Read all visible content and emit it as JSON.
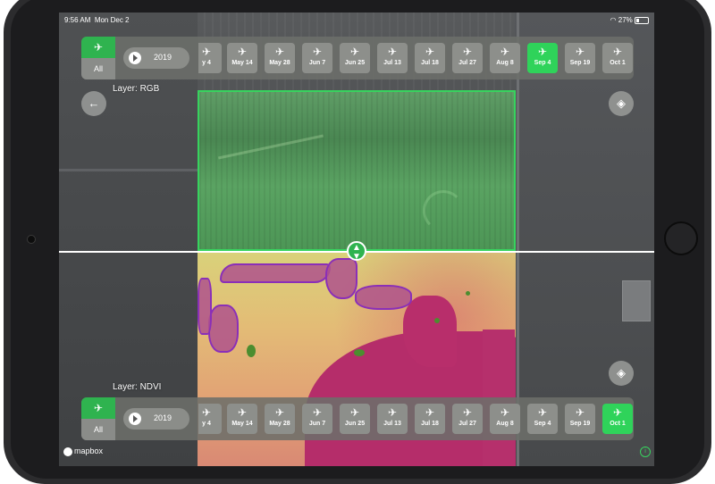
{
  "status": {
    "time": "9:56 AM",
    "date": "Mon Dec 2",
    "battery": "27%"
  },
  "timeline_top": {
    "all_label": "All",
    "year": "2019",
    "dates": [
      "y 4",
      "May 14",
      "May 28",
      "Jun 7",
      "Jun 25",
      "Jul 13",
      "Jul 18",
      "Jul 27",
      "Aug 8",
      "Sep 4",
      "Sep 19",
      "Oct 1"
    ],
    "active_date": "Sep 4"
  },
  "timeline_bottom": {
    "all_label": "All",
    "year": "2019",
    "dates": [
      "y 4",
      "May 14",
      "May 28",
      "Jun 7",
      "Jun 25",
      "Jul 13",
      "Jul 18",
      "Jul 27",
      "Aug 8",
      "Sep 4",
      "Sep 19",
      "Oct 1"
    ],
    "active_date": "Oct 1"
  },
  "layers": {
    "top_label": "Layer: RGB",
    "bottom_label": "Layer: NDVI"
  },
  "attribution": {
    "mapbox": "mapbox",
    "info": "i"
  },
  "colors": {
    "accent": "#2fd35a",
    "chip": "#8d8f8b"
  },
  "icons": {
    "back": "arrow-left-icon",
    "layers": "layers-icon",
    "plane": "airplane-icon",
    "play": "play-icon",
    "compare": "up-down-arrows-icon"
  }
}
